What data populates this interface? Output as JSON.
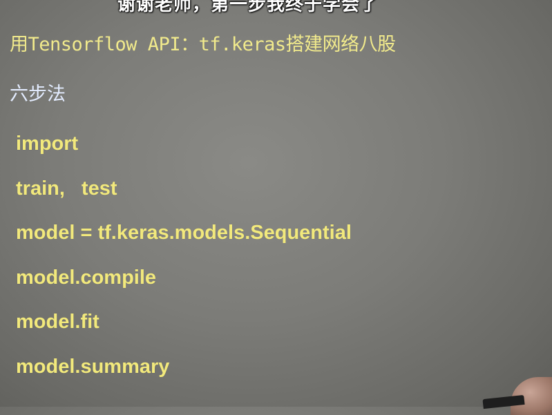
{
  "video": {
    "danmaku_comment": "谢谢老师，第一步我终于学会了"
  },
  "slide": {
    "title": "用Tensorflow API：tf.keras搭建网络八股",
    "subtitle": "六步法",
    "steps": [
      {
        "label": "import"
      },
      {
        "label": "train,",
        "extra": "test"
      },
      {
        "label": "model = tf.keras.models.Sequential"
      },
      {
        "label": "model.compile"
      },
      {
        "label": "model.fit"
      },
      {
        "label": "model.summary"
      }
    ]
  },
  "colors": {
    "background": "#7c7c78",
    "title_text": "#f1ea8c",
    "subtitle_text": "#e3ecff",
    "step_text": "#f2e97c",
    "danmaku_text": "#ffffff"
  }
}
